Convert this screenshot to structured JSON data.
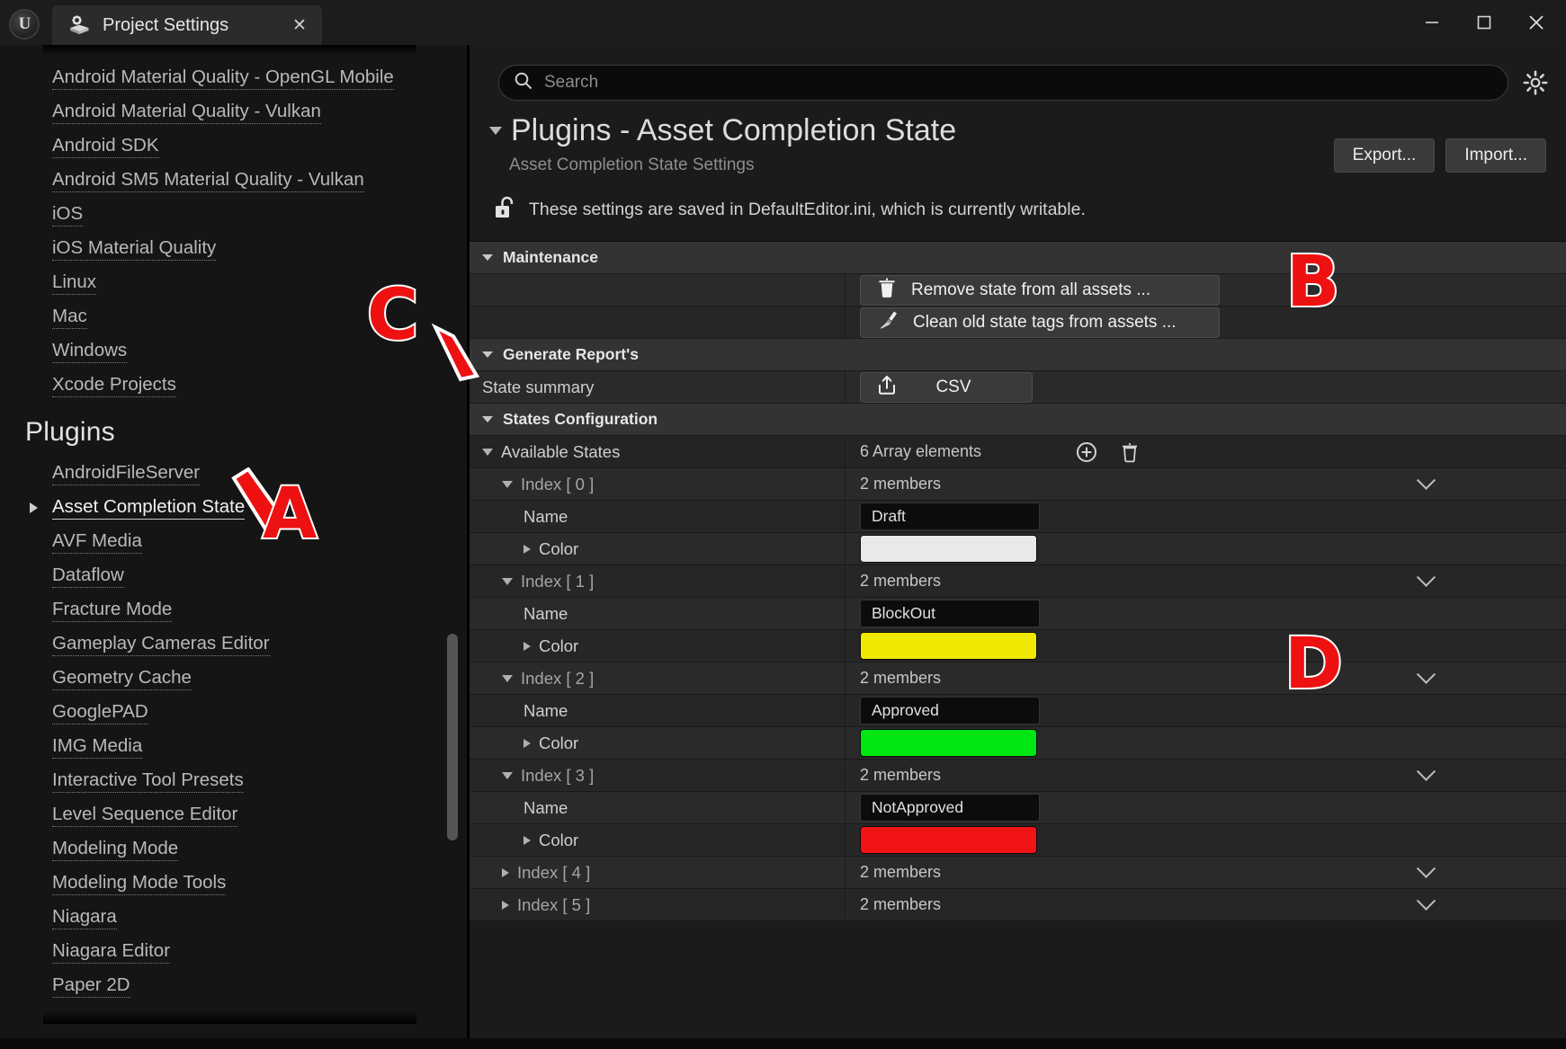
{
  "window": {
    "app_logo": "unreal-engine-logo",
    "tab_title": "Project Settings",
    "tab_icon": "settings-box-icon",
    "close_label": "✕",
    "minimize_label": "─",
    "maximize_label": "☐",
    "window_close_label": "✕"
  },
  "sidebar": {
    "top_items": [
      {
        "label": "Android Material Quality - OpenGL Mobile"
      },
      {
        "label": "Android Material Quality - Vulkan"
      },
      {
        "label": "Android SDK"
      },
      {
        "label": "Android SM5 Material Quality - Vulkan"
      },
      {
        "label": "iOS"
      },
      {
        "label": "iOS Material Quality"
      },
      {
        "label": "Linux"
      },
      {
        "label": "Mac"
      },
      {
        "label": "Windows"
      },
      {
        "label": "Xcode Projects"
      }
    ],
    "plugins_heading": "Plugins",
    "plugin_items": [
      {
        "label": "AndroidFileServer",
        "selected": false,
        "expandable": false
      },
      {
        "label": "Asset Completion State",
        "selected": true,
        "expandable": true
      },
      {
        "label": "AVF Media",
        "selected": false,
        "expandable": false
      },
      {
        "label": "Dataflow",
        "selected": false,
        "expandable": false
      },
      {
        "label": "Fracture Mode",
        "selected": false,
        "expandable": false
      },
      {
        "label": "Gameplay Cameras Editor",
        "selected": false,
        "expandable": false
      },
      {
        "label": "Geometry Cache",
        "selected": false,
        "expandable": false
      },
      {
        "label": "GooglePAD",
        "selected": false,
        "expandable": false
      },
      {
        "label": "IMG Media",
        "selected": false,
        "expandable": false
      },
      {
        "label": "Interactive Tool Presets",
        "selected": false,
        "expandable": false
      },
      {
        "label": "Level Sequence Editor",
        "selected": false,
        "expandable": false
      },
      {
        "label": "Modeling Mode",
        "selected": false,
        "expandable": false
      },
      {
        "label": "Modeling Mode Tools",
        "selected": false,
        "expandable": false
      },
      {
        "label": "Niagara",
        "selected": false,
        "expandable": false
      },
      {
        "label": "Niagara Editor",
        "selected": false,
        "expandable": false
      },
      {
        "label": "Paper 2D",
        "selected": false,
        "expandable": false
      }
    ]
  },
  "search": {
    "value": "",
    "placeholder": "Search",
    "icon": "search-icon",
    "settings_icon": "gear-icon"
  },
  "page": {
    "title": "Plugins - Asset Completion State",
    "subtitle": "Asset Completion State Settings",
    "export_label": "Export...",
    "import_label": "Import...",
    "ini_icon": "unlocked-padlock-icon",
    "ini_notice": "These settings are saved in DefaultEditor.ini, which is currently writable."
  },
  "sections": {
    "maintenance": {
      "label": "Maintenance",
      "buttons": [
        {
          "label": "Remove state from all assets ...",
          "icon": "trash-icon"
        },
        {
          "label": "Clean old state tags from assets ...",
          "icon": "broom-icon"
        }
      ]
    },
    "reports": {
      "label": "Generate Report's",
      "rows": [
        {
          "name": "State summary",
          "button_label": "CSV",
          "button_icon": "export-share-icon"
        }
      ]
    },
    "states_config": {
      "label": "States Configuration",
      "available_states": {
        "label": "Available States",
        "count_label": "6 Array elements",
        "add_icon": "plus-circle-icon",
        "delete_icon": "trash-icon",
        "members_label": "2 members",
        "name_field_label": "Name",
        "color_field_label": "Color",
        "elements": [
          {
            "index_label": "Index [ 0 ]",
            "members": "2 members",
            "expanded": true,
            "name": "Draft",
            "color": "#e9e9e9"
          },
          {
            "index_label": "Index [ 1 ]",
            "members": "2 members",
            "expanded": true,
            "name": "BlockOut",
            "color": "#f0e800"
          },
          {
            "index_label": "Index [ 2 ]",
            "members": "2 members",
            "expanded": true,
            "name": "Approved",
            "color": "#00e612"
          },
          {
            "index_label": "Index [ 3 ]",
            "members": "2 members",
            "expanded": true,
            "name": "NotApproved",
            "color": "#f01414"
          },
          {
            "index_label": "Index [ 4 ]",
            "members": "2 members",
            "expanded": false,
            "name": "",
            "color": ""
          },
          {
            "index_label": "Index [ 5 ]",
            "members": "2 members",
            "expanded": false,
            "name": "",
            "color": ""
          }
        ]
      }
    }
  },
  "annotations": [
    {
      "letter": "A"
    },
    {
      "letter": "B"
    },
    {
      "letter": "C"
    },
    {
      "letter": "D"
    }
  ]
}
